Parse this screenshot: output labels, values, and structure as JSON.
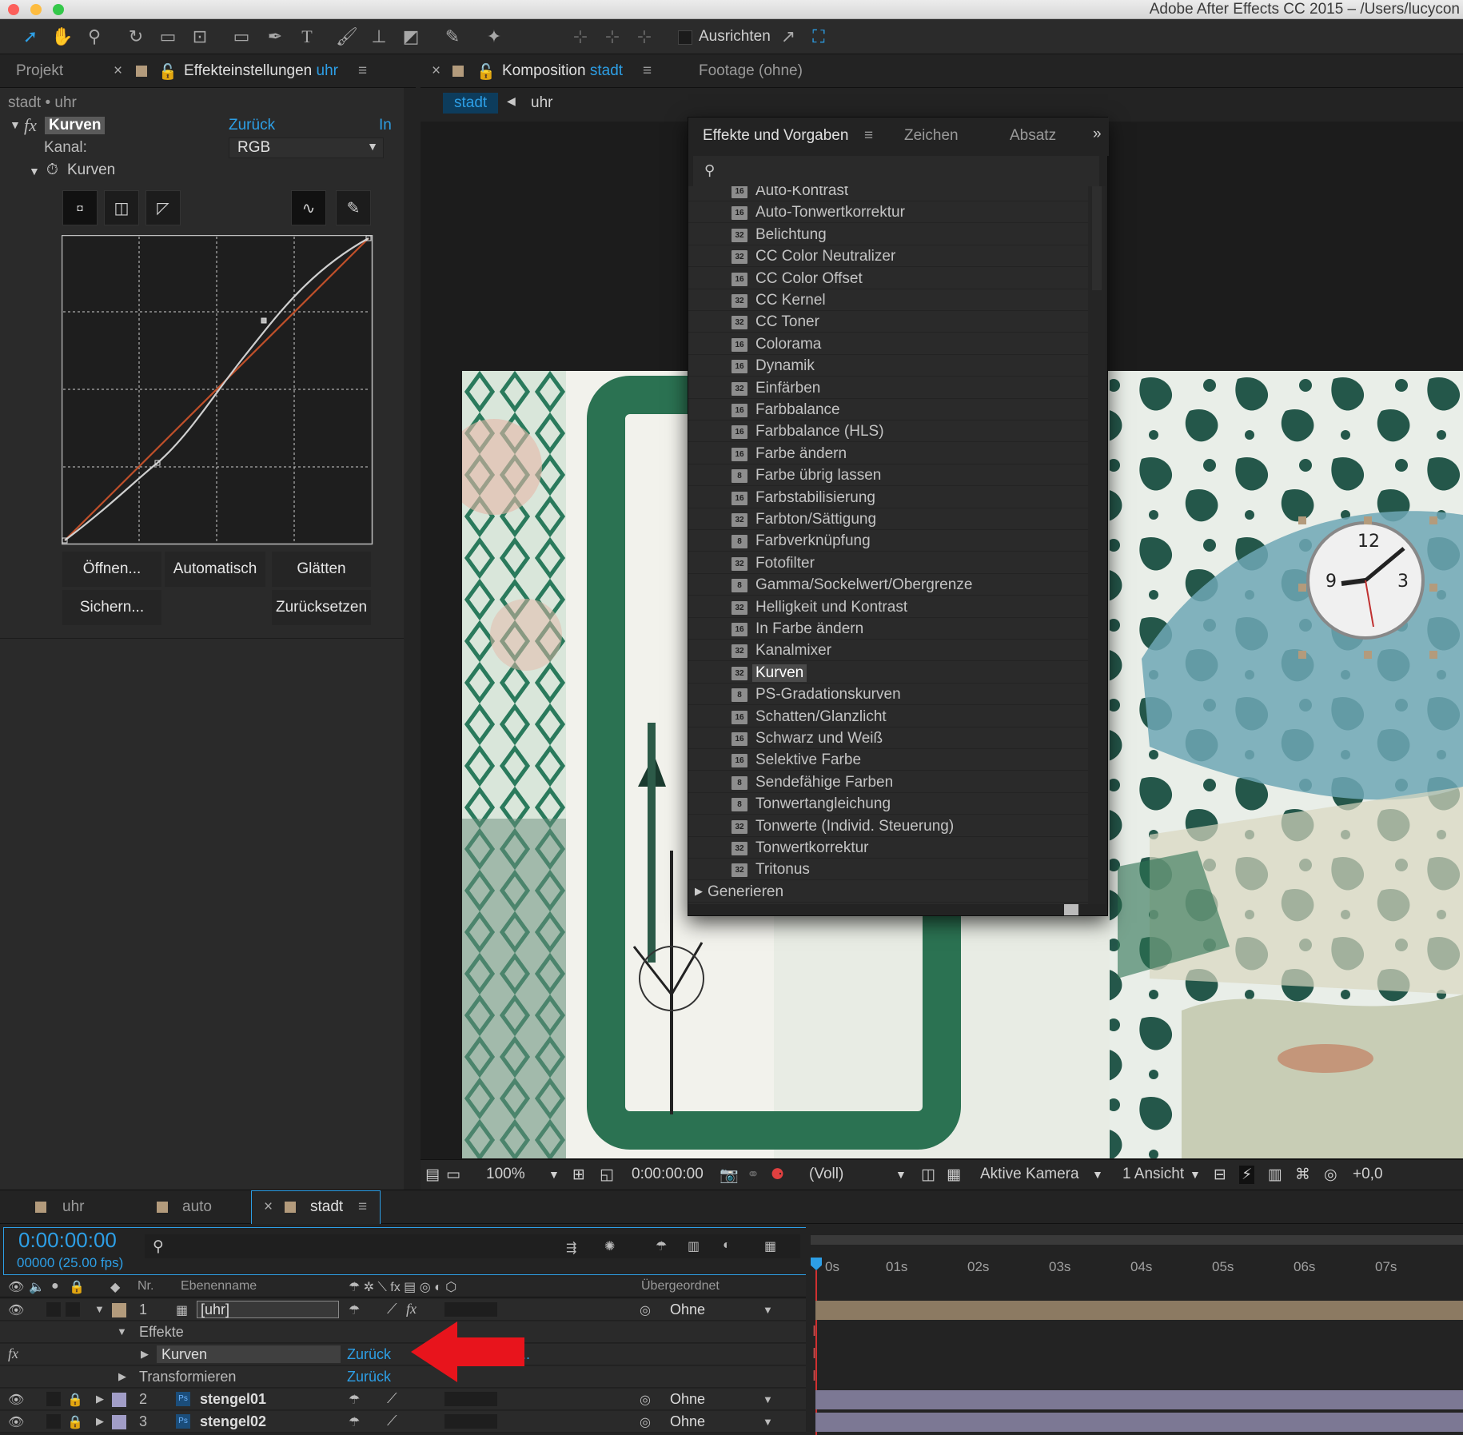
{
  "window": {
    "title": "Adobe After Effects CC 2015 – /Users/lucycon"
  },
  "toolbar": {
    "align_label": "Ausrichten"
  },
  "effect_controls": {
    "tab_project": "Projekt",
    "tab_title": "Effekteinstellungen",
    "tab_layer": "uhr",
    "breadcrumb": "stadt • uhr",
    "effect_name": "Kurven",
    "reset_label": "Zurück",
    "about_label": "In",
    "channel_label": "Kanal:",
    "channel_value": "RGB",
    "curves_label": "Kurven",
    "buttons": {
      "open": "Öffnen...",
      "auto": "Automatisch",
      "smooth": "Glätten",
      "save": "Sichern...",
      "reset": "Zurücksetzen"
    }
  },
  "composition": {
    "tab_title": "Komposition",
    "tab_comp": "stadt",
    "tab_footage": "Footage (ohne)",
    "crumb_active": "stadt",
    "crumb_child": "uhr",
    "zoom": "100%",
    "timecode": "0:00:00:00",
    "resolution": "(Voll)",
    "camera": "Aktive Kamera",
    "views": "1 Ansicht",
    "exposure": "+0,0"
  },
  "effects_panel": {
    "tab_effects": "Effekte und Vorgaben",
    "tab_char": "Zeichen",
    "tab_para": "Absatz",
    "items": [
      {
        "bits": "16",
        "label": "Auto-Kontrast"
      },
      {
        "bits": "16",
        "label": "Auto-Tonwertkorrektur"
      },
      {
        "bits": "32",
        "label": "Belichtung"
      },
      {
        "bits": "32",
        "label": "CC Color Neutralizer"
      },
      {
        "bits": "16",
        "label": "CC Color Offset"
      },
      {
        "bits": "32",
        "label": "CC Kernel"
      },
      {
        "bits": "32",
        "label": "CC Toner"
      },
      {
        "bits": "16",
        "label": "Colorama"
      },
      {
        "bits": "16",
        "label": "Dynamik"
      },
      {
        "bits": "32",
        "label": "Einfärben"
      },
      {
        "bits": "16",
        "label": "Farbbalance"
      },
      {
        "bits": "16",
        "label": "Farbbalance (HLS)"
      },
      {
        "bits": "16",
        "label": "Farbe ändern"
      },
      {
        "bits": "8",
        "label": "Farbe übrig lassen"
      },
      {
        "bits": "16",
        "label": "Farbstabilisierung"
      },
      {
        "bits": "32",
        "label": "Farbton/Sättigung"
      },
      {
        "bits": "8",
        "label": "Farbverknüpfung"
      },
      {
        "bits": "32",
        "label": "Fotofilter"
      },
      {
        "bits": "8",
        "label": "Gamma/Sockelwert/Obergrenze"
      },
      {
        "bits": "32",
        "label": "Helligkeit und Kontrast"
      },
      {
        "bits": "16",
        "label": "In Farbe ändern"
      },
      {
        "bits": "32",
        "label": "Kanalmixer"
      },
      {
        "bits": "32",
        "label": "Kurven",
        "selected": true
      },
      {
        "bits": "8",
        "label": "PS-Gradationskurven"
      },
      {
        "bits": "16",
        "label": "Schatten/Glanzlicht"
      },
      {
        "bits": "16",
        "label": "Schwarz und Weiß"
      },
      {
        "bits": "16",
        "label": "Selektive Farbe"
      },
      {
        "bits": "8",
        "label": "Sendefähige Farben"
      },
      {
        "bits": "8",
        "label": "Tonwertangleichung"
      },
      {
        "bits": "32",
        "label": "Tonwerte (Individ. Steuerung)"
      },
      {
        "bits": "32",
        "label": "Tonwertkorrektur"
      },
      {
        "bits": "32",
        "label": "Tritonus"
      }
    ],
    "next_group": "Generieren"
  },
  "timeline": {
    "tabs": [
      "uhr",
      "auto",
      "stadt"
    ],
    "timecode": "0:00:00:00",
    "frames": "00000 (25.00 fps)",
    "col_nr": "Nr.",
    "col_name": "Ebenenname",
    "col_parent": "Übergeordnet",
    "ruler": [
      "0s",
      "01s",
      "02s",
      "03s",
      "04s",
      "05s",
      "06s",
      "07s"
    ],
    "layers": [
      {
        "nr": "1",
        "name": "[uhr]",
        "parent": "Ohne"
      },
      {
        "nr": "2",
        "name": "stengel01",
        "parent": "Ohne"
      },
      {
        "nr": "3",
        "name": "stengel02",
        "parent": "Ohne"
      }
    ],
    "effects_group": "Effekte",
    "effect_row": "Kurven",
    "effect_reset": "Zurück",
    "effect_trail": "...",
    "transform_row": "Transformieren",
    "transform_reset": "Zurück"
  },
  "colors": {
    "accent": "#2d9fe6",
    "arrow": "#e8141c",
    "layer_tan": "#b39b7c",
    "layer_purple": "#a19dc7"
  }
}
